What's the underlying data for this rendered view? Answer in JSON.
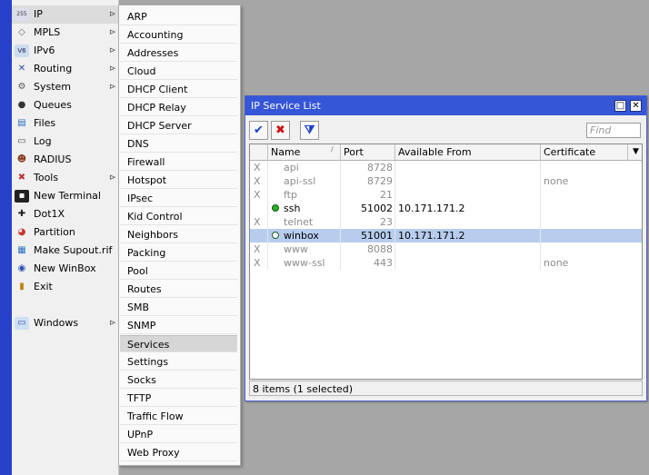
{
  "main_menu": {
    "items": [
      {
        "label": "IP",
        "icon": "ip-icon",
        "has_submenu": true,
        "active": true
      },
      {
        "label": "MPLS",
        "icon": "mpls-icon",
        "has_submenu": true
      },
      {
        "label": "IPv6",
        "icon": "ipv6-icon",
        "has_submenu": true
      },
      {
        "label": "Routing",
        "icon": "routing-icon",
        "has_submenu": true
      },
      {
        "label": "System",
        "icon": "system-gear-icon",
        "has_submenu": true
      },
      {
        "label": "Queues",
        "icon": "queues-icon",
        "has_submenu": false
      },
      {
        "label": "Files",
        "icon": "files-icon",
        "has_submenu": false
      },
      {
        "label": "Log",
        "icon": "log-icon",
        "has_submenu": false
      },
      {
        "label": "RADIUS",
        "icon": "radius-icon",
        "has_submenu": false
      },
      {
        "label": "Tools",
        "icon": "tools-icon",
        "has_submenu": true
      },
      {
        "label": "New Terminal",
        "icon": "terminal-icon",
        "has_submenu": false
      },
      {
        "label": "Dot1X",
        "icon": "dot1x-icon",
        "has_submenu": false
      },
      {
        "label": "Partition",
        "icon": "partition-icon",
        "has_submenu": false
      },
      {
        "label": "Make Supout.rif",
        "icon": "supout-icon",
        "has_submenu": false
      },
      {
        "label": "New WinBox",
        "icon": "winbox-icon",
        "has_submenu": false
      },
      {
        "label": "Exit",
        "icon": "exit-icon",
        "has_submenu": false
      },
      {
        "label": "Windows",
        "icon": "windows-icon",
        "has_submenu": true
      }
    ]
  },
  "ip_submenu": {
    "items": [
      "ARP",
      "Accounting",
      "Addresses",
      "Cloud",
      "DHCP Client",
      "DHCP Relay",
      "DHCP Server",
      "DNS",
      "Firewall",
      "Hotspot",
      "IPsec",
      "Kid Control",
      "Neighbors",
      "Packing",
      "Pool",
      "Routes",
      "SMB",
      "SNMP",
      "Services",
      "Settings",
      "Socks",
      "TFTP",
      "Traffic Flow",
      "UPnP",
      "Web Proxy"
    ],
    "selected": "Services"
  },
  "window": {
    "title": "IP Service List",
    "restore_symbol": "□",
    "close_symbol": "✕",
    "toolbar": {
      "enable_symbol": "✔",
      "disable_symbol": "✖",
      "filter_symbol": "⧩",
      "find_placeholder": "Find"
    },
    "columns": {
      "name": "Name",
      "port": "Port",
      "available_from": "Available From",
      "certificate": "Certificate"
    },
    "rows": [
      {
        "flag": "X",
        "name": "api",
        "port": "8728",
        "available_from": "",
        "certificate": "",
        "disabled": true
      },
      {
        "flag": "X",
        "name": "api-ssl",
        "port": "8729",
        "available_from": "",
        "certificate": "none",
        "disabled": true
      },
      {
        "flag": "X",
        "name": "ftp",
        "port": "21",
        "available_from": "",
        "certificate": "",
        "disabled": true
      },
      {
        "flag": "",
        "name": "ssh",
        "port": "51002",
        "available_from": "10.171.171.2",
        "certificate": "",
        "disabled": false
      },
      {
        "flag": "X",
        "name": "telnet",
        "port": "23",
        "available_from": "",
        "certificate": "",
        "disabled": true
      },
      {
        "flag": "",
        "name": "winbox",
        "port": "51001",
        "available_from": "10.171.171.2",
        "certificate": "",
        "disabled": false,
        "selected": true
      },
      {
        "flag": "X",
        "name": "www",
        "port": "8088",
        "available_from": "",
        "certificate": "",
        "disabled": true
      },
      {
        "flag": "X",
        "name": "www-ssl",
        "port": "443",
        "available_from": "",
        "certificate": "none",
        "disabled": true
      }
    ],
    "status": "8 items (1 selected)"
  },
  "colors": {
    "title_bar": "#3556d6",
    "selected_row": "#b8cdee",
    "side_bar": "#2741c9",
    "enabled_dot": "#27b027"
  }
}
